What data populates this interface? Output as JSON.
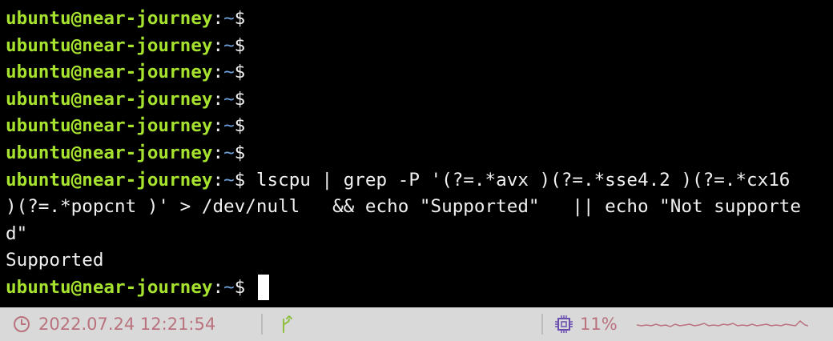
{
  "terminal": {
    "prompt": {
      "user_host": "ubuntu@near-journey",
      "colon": ":",
      "path": "~",
      "symbol": "$"
    },
    "empty_prompt_lines": 6,
    "command": {
      "line1": " lscpu | grep -P '(?=.*avx )(?=.*sse4.2 )(?=.*cx16",
      "line2": ")(?=.*popcnt )' > /dev/null   && echo \"Supported\"   || echo \"Not supporte",
      "line3": "d\""
    },
    "output": "Supported"
  },
  "status_bar": {
    "datetime": "2022.07.24 12:21:54",
    "cpu_usage": "11%",
    "accent_color": "#b9727e",
    "background_color": "#d9d9d9",
    "git_icon": "git-branch-icon",
    "clock_icon": "clock-icon",
    "cpu_icon": "cpu-chip-icon"
  }
}
